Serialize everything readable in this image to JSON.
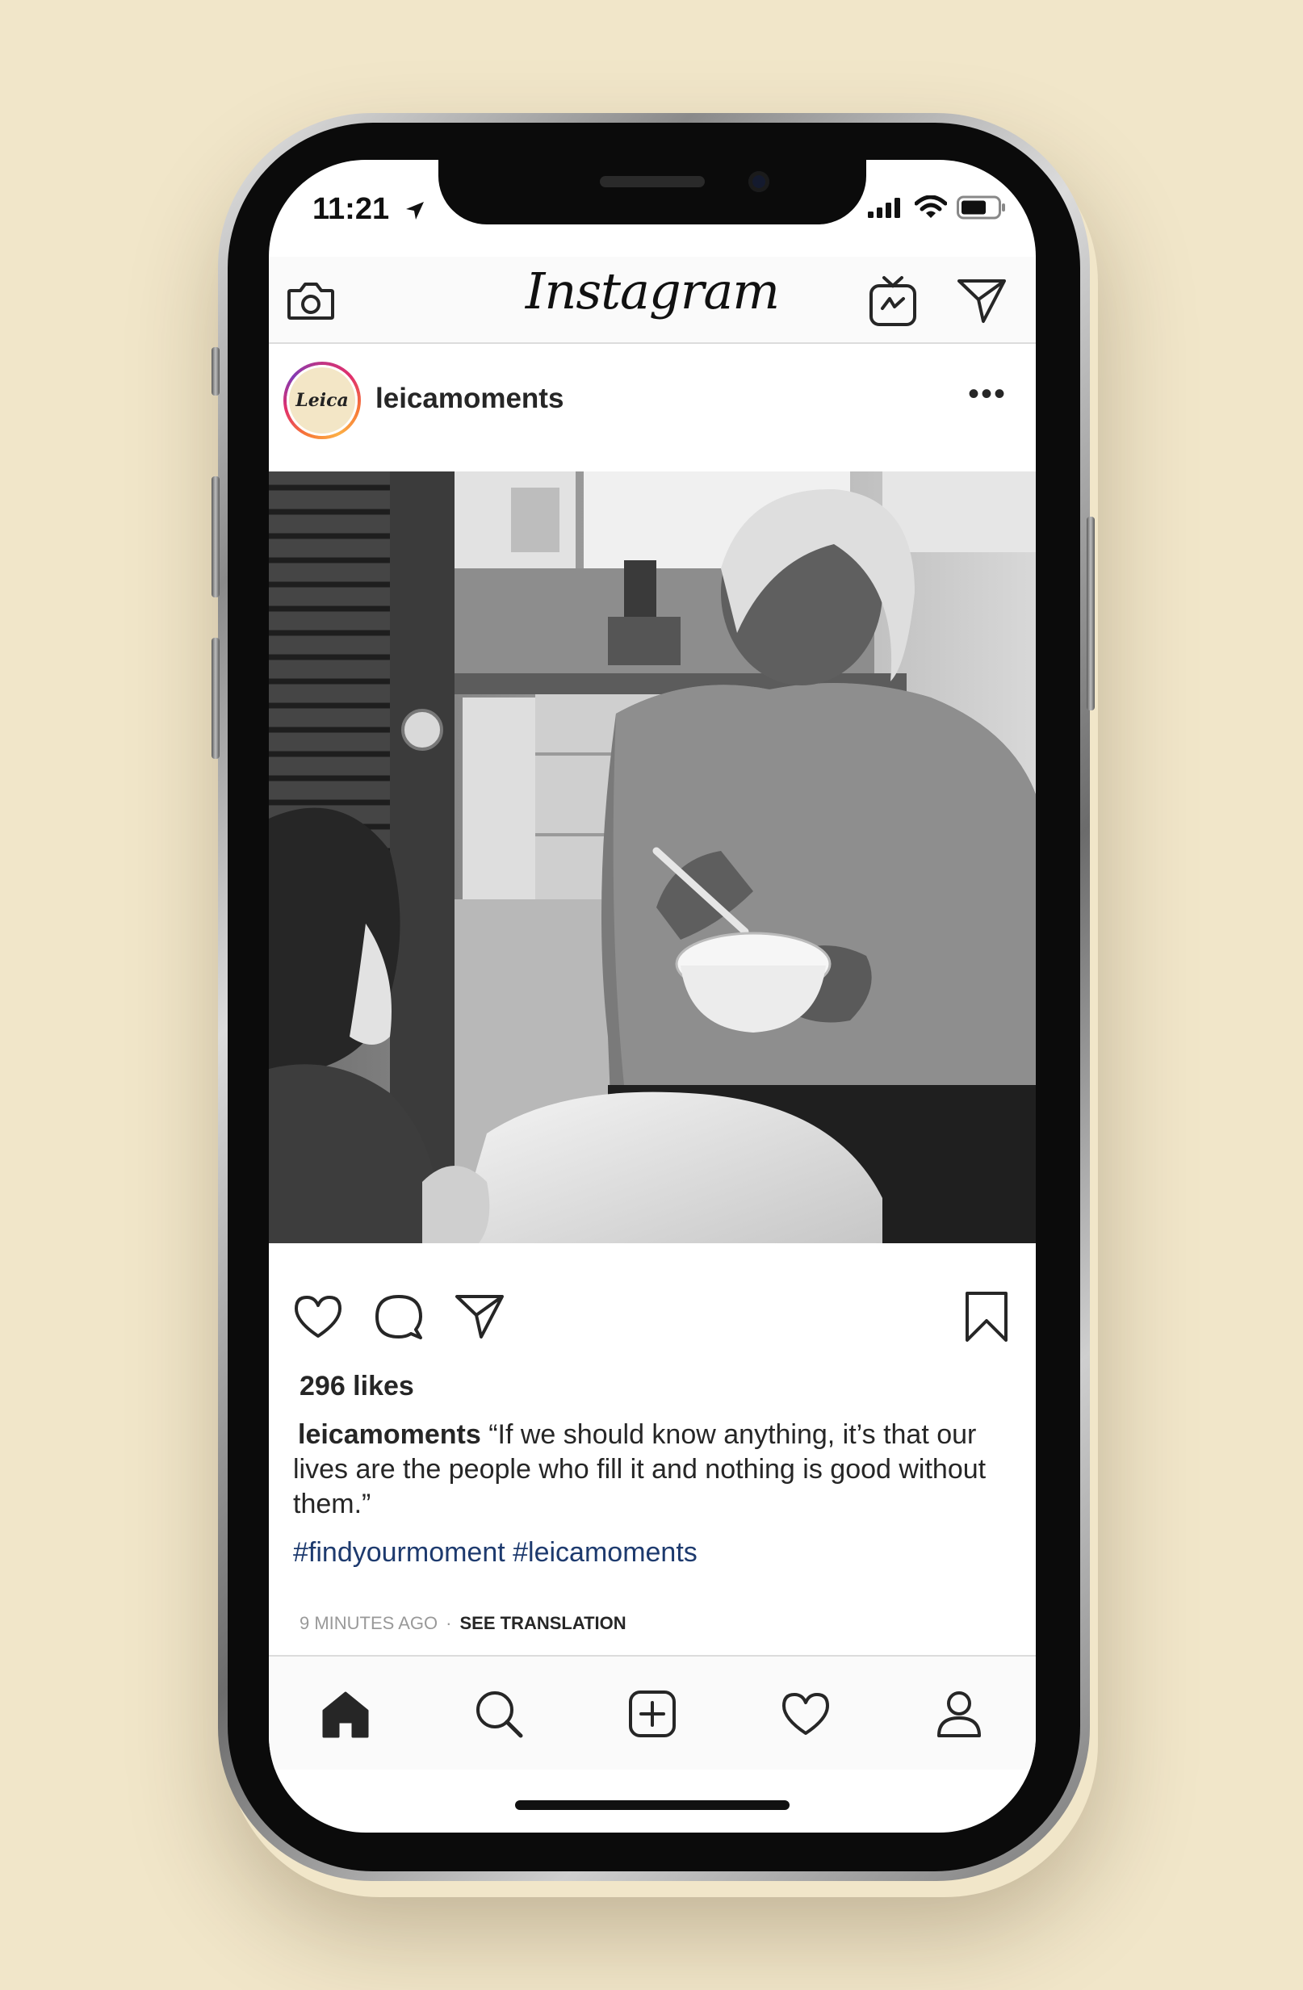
{
  "status_bar": {
    "time": "11:21"
  },
  "top_bar": {
    "logo_text": "Instagram"
  },
  "post": {
    "avatar_text": "Leica",
    "username": "leicamoments",
    "more_glyph": "•••",
    "likes": "296 likes",
    "caption_user": "leicamoments",
    "caption_text": "“If we should know anything, it’s that our lives are the people who fill it and nothing is good without them.”",
    "hashtags": "#findyourmoment #leicamoments",
    "time_ago": "9 MINUTES AGO",
    "separator": "·",
    "translate_label": "SEE TRANSLATION"
  },
  "icons": {
    "camera": "camera-icon",
    "igtv": "igtv-icon",
    "direct": "direct-message-icon",
    "like": "heart-icon",
    "comment": "comment-icon",
    "share": "share-icon",
    "save": "bookmark-icon",
    "home": "home-icon",
    "search": "search-icon",
    "new_post": "new-post-icon",
    "activity": "activity-heart-icon",
    "profile": "profile-icon"
  },
  "colors": {
    "background": "#f1e6c9",
    "hashtag": "#1d3a6e",
    "text": "#262626"
  }
}
